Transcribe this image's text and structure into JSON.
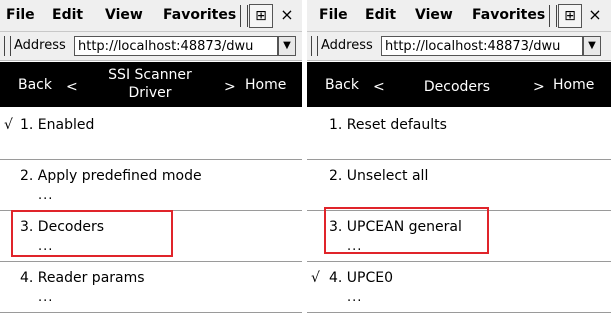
{
  "left": {
    "menu": [
      "File",
      "Edit",
      "View",
      "Favorites"
    ],
    "network_icon": "network-icon",
    "close_label": "×",
    "address_label": "Address",
    "address_value": "http://localhost:48873/dwu",
    "nav": {
      "back": "Back",
      "back_arrow": "<",
      "title_line1": "SSI Scanner",
      "title_line2": "Driver",
      "home_arrow": ">",
      "home": "Home"
    },
    "items": [
      {
        "label": "1. Enabled",
        "checked": true,
        "check": "√",
        "dots": ""
      },
      {
        "label": "2. Apply predefined mode",
        "checked": false,
        "check": "",
        "dots": "..."
      },
      {
        "label": "3. Decoders",
        "checked": false,
        "check": "",
        "dots": "..."
      },
      {
        "label": "4. Reader params",
        "checked": false,
        "check": "",
        "dots": "..."
      }
    ]
  },
  "right": {
    "menu": [
      "File",
      "Edit",
      "View",
      "Favorites"
    ],
    "network_icon": "network-icon",
    "close_label": "×",
    "address_label": "Address",
    "address_value": "http://localhost:48873/dwu",
    "nav": {
      "back": "Back",
      "back_arrow": "<",
      "title": "Decoders",
      "home_arrow": ">",
      "home": "Home"
    },
    "items": [
      {
        "label": "1. Reset defaults",
        "checked": false,
        "check": "",
        "dots": ""
      },
      {
        "label": "2. Unselect all",
        "checked": false,
        "check": "",
        "dots": ""
      },
      {
        "label": "3. UPCEAN general",
        "checked": false,
        "check": "",
        "dots": "..."
      },
      {
        "label": "4. UPCE0",
        "checked": true,
        "check": "√",
        "dots": "..."
      }
    ]
  },
  "colors": {
    "highlight": "#e0242a",
    "navbar_bg": "#000000",
    "menubar_bg": "#efefef"
  }
}
